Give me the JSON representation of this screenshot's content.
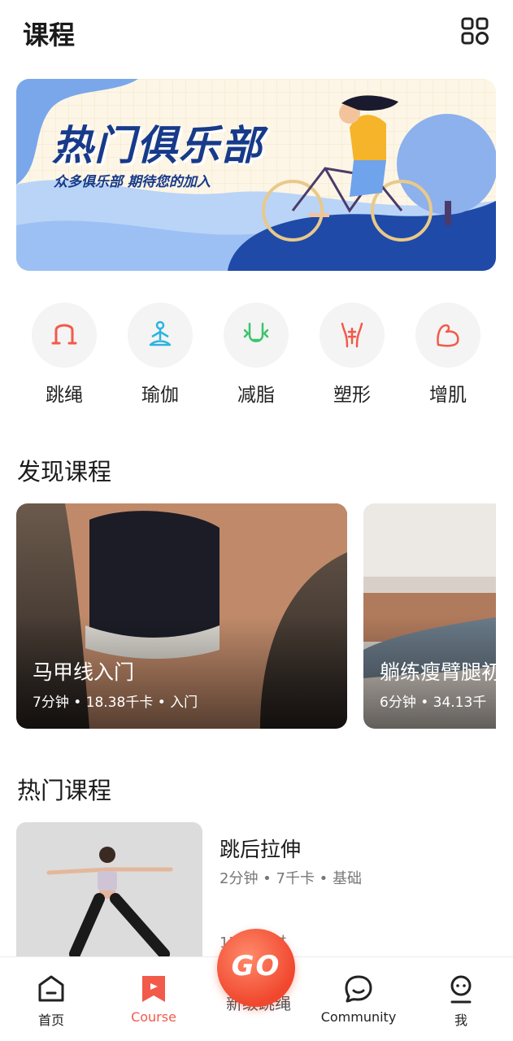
{
  "header": {
    "title": "课程",
    "grid_icon": "grid-icon"
  },
  "banner": {
    "title": "热门俱乐部",
    "subtitle": "众多俱乐部  期待您的加入"
  },
  "categories": [
    {
      "label": "跳绳",
      "icon": "jump-rope-icon",
      "color": "#f25a4a"
    },
    {
      "label": "瑜伽",
      "icon": "yoga-icon",
      "color": "#2bb4e0"
    },
    {
      "label": "减脂",
      "icon": "fat-loss-icon",
      "color": "#3cc36a"
    },
    {
      "label": "塑形",
      "icon": "body-shape-icon",
      "color": "#f25a4a"
    },
    {
      "label": "增肌",
      "icon": "muscle-icon",
      "color": "#f25a4a"
    }
  ],
  "discover": {
    "title": "发现课程",
    "cards": [
      {
        "name": "马甲线入门",
        "meta": "7分钟  •  18.38千卡  •  入门"
      },
      {
        "name": "躺练瘦臂腿初",
        "meta": "6分钟  •  34.13千"
      }
    ]
  },
  "hot": {
    "title": "热门课程",
    "course": {
      "name": "跳后拉伸",
      "meta": "2分钟  •  7千卡  •  基础",
      "count": "17          人练过"
    }
  },
  "tabbar": {
    "tabs": [
      {
        "label": "首页",
        "icon": "home-icon"
      },
      {
        "label": "Course",
        "icon": "course-bookmark-icon"
      },
      {
        "label": "Community",
        "icon": "community-chat-icon"
      },
      {
        "label": "我",
        "icon": "profile-icon"
      }
    ],
    "go_label": "GO",
    "go_under": "新级跳绳",
    "active_color": "#f25a4a"
  }
}
